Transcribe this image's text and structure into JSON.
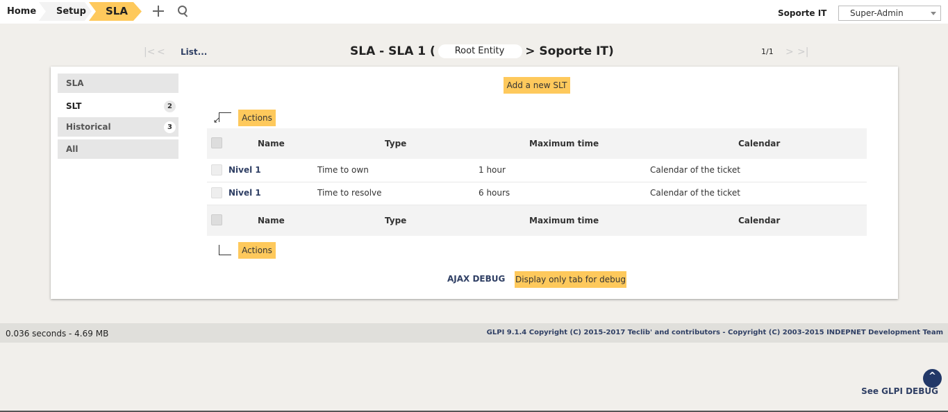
{
  "breadcrumb": {
    "home": "Home",
    "setup": "Setup",
    "current": "SLA"
  },
  "header": {
    "entity": "Soporte IT",
    "profile": "Super-Admin"
  },
  "navigation": {
    "first": "|<",
    "prev": "<",
    "list_label": "List...",
    "title_prefix": "SLA - SLA 1 (",
    "entity_pill": "Root Entity",
    "title_suffix": "> Soporte IT)",
    "counter": "1/1",
    "next": ">",
    "last": ">|"
  },
  "tabs": [
    {
      "label": "SLA",
      "count": ""
    },
    {
      "label": "SLT",
      "count": "2"
    },
    {
      "label": "Historical",
      "count": "3"
    },
    {
      "label": "All",
      "count": ""
    }
  ],
  "actions": {
    "add_label": "Add a new SLT",
    "actions_label": "Actions"
  },
  "table": {
    "columns": [
      "Name",
      "Type",
      "Maximum time",
      "Calendar"
    ],
    "rows": [
      {
        "name": "Nivel 1",
        "type": "Time to own",
        "max_time": "1 hour",
        "calendar": "Calendar of the ticket"
      },
      {
        "name": "Nivel 1",
        "type": "Time to resolve",
        "max_time": "6 hours",
        "calendar": "Calendar of the ticket"
      }
    ]
  },
  "debug": {
    "ajax_label": "AJAX DEBUG",
    "only_tab_label": "Display only tab for debug",
    "see_label": "See GLPI DEBUG",
    "top_label": "^"
  },
  "footer": {
    "stats": "0.036 seconds - 4.69 MB",
    "copyright": "GLPI 9.1.4 Copyright (C) 2015-2017 Teclib' and contributors - Copyright (C) 2003-2015 INDEPNET Development Team"
  },
  "colors": {
    "accent": "#fec95c",
    "link": "#2f3f64",
    "background": "#f1efeb"
  }
}
